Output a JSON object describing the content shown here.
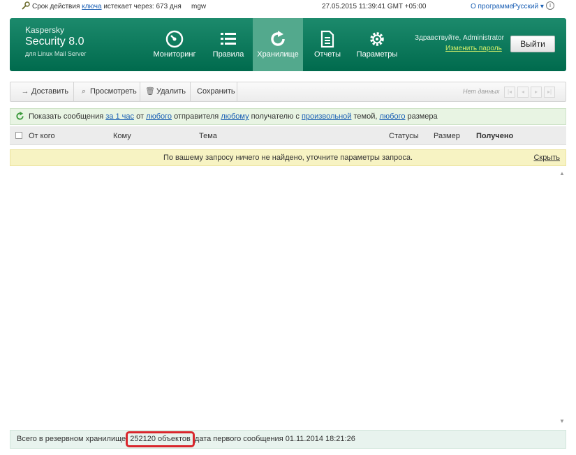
{
  "topbar": {
    "license_prefix": "Срок действия",
    "license_link": "ключа",
    "license_suffix": "истекает через:",
    "license_days": "673 дня",
    "hostname": "mgw",
    "datetime": "27.05.2015 11:39:41 GMT +05:00",
    "about": "О программе",
    "language": "Русский ▾",
    "info_icon": "i"
  },
  "brand": {
    "line1": "Kaspersky",
    "line2": "Security 8.0",
    "line3": "для Linux Mail Server"
  },
  "nav": [
    {
      "label": "Мониторинг",
      "icon": "gauge-icon"
    },
    {
      "label": "Правила",
      "icon": "list-icon"
    },
    {
      "label": "Хранилище",
      "icon": "refresh-icon"
    },
    {
      "label": "Отчеты",
      "icon": "document-icon"
    },
    {
      "label": "Параметры",
      "icon": "gear-icon"
    }
  ],
  "user": {
    "greeting": "Здравствуйте, Administrator",
    "change_password": "Изменить пароль",
    "logout": "Выйти"
  },
  "toolbar": {
    "deliver": "Доставить",
    "view": "Просмотреть",
    "delete": "Удалить",
    "save": "Сохранить",
    "no_data": "Нет данных"
  },
  "filter": {
    "t1": "Показать сообщения",
    "period": "за 1 час",
    "t2": "от",
    "sender": "любого",
    "t3": "отправителя",
    "recipient": "любому",
    "t4": "получателю с",
    "subject": "произвольной",
    "t5": "темой,",
    "size": "любого",
    "t6": "размера"
  },
  "columns": {
    "from": "От кого",
    "to": "Кому",
    "subject": "Тема",
    "statuses": "Статусы",
    "size": "Размер",
    "received": "Получено"
  },
  "warning": {
    "message": "По вашему запросу ничего не найдено, уточните параметры запроса.",
    "hide": "Скрыть"
  },
  "footer": {
    "prefix": "Всего в резервном хранилище",
    "count": "252120 объектов",
    "suffix": "дата первого сообщения 01.11.2014 18:21:26"
  },
  "colors": {
    "header_green": "#006a4d",
    "active_tab": "#53a98d",
    "highlight_red": "#d9262c"
  }
}
